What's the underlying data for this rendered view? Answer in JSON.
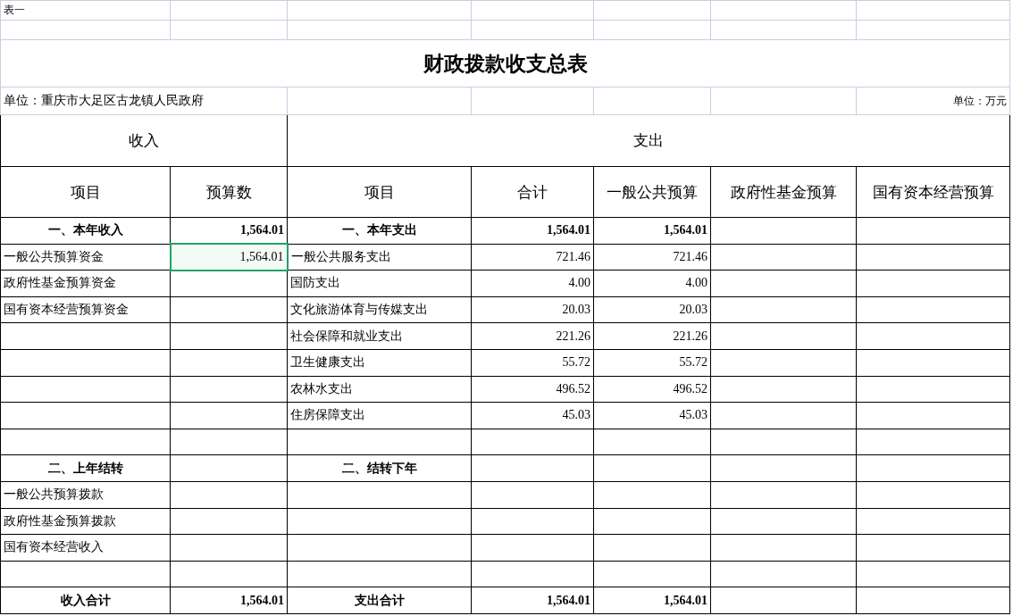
{
  "sheet": {
    "label": "表一"
  },
  "title": "财政拨款收支总表",
  "unit_row": {
    "organization": "单位：重庆市大足区古龙镇人民政府",
    "unit": "单位：万元"
  },
  "header": {
    "income": "收入",
    "expense": "支出",
    "columns": [
      "项目",
      "预算数",
      "项目",
      "合计",
      "一般公共预算",
      "政府性基金预算",
      "国有资本经营预算"
    ]
  },
  "rows": [
    {
      "kind": "section",
      "cells": [
        {
          "text": "一、本年收入",
          "selected": false
        },
        {
          "text": "1,564.01",
          "selected": false
        },
        {
          "text": "一、本年支出",
          "selected": false
        },
        {
          "text": "1,564.01",
          "selected": false
        },
        {
          "text": "1,564.01",
          "selected": false
        },
        {
          "selected": false
        },
        {
          "selected": false
        }
      ]
    },
    {
      "kind": "item",
      "cells": [
        {
          "text": "一般公共预算资金",
          "selected": false
        },
        {
          "text": "1,564.01",
          "selected": true
        },
        {
          "text": "一般公共服务支出",
          "selected": false
        },
        {
          "text": "721.46",
          "selected": false
        },
        {
          "text": "721.46",
          "selected": false
        },
        {
          "selected": false
        },
        {
          "selected": false
        }
      ]
    },
    {
      "kind": "item",
      "cells": [
        {
          "text": "政府性基金预算资金",
          "selected": false
        },
        {
          "selected": false
        },
        {
          "text": "国防支出",
          "selected": false
        },
        {
          "text": "4.00",
          "selected": false
        },
        {
          "text": "4.00",
          "selected": false
        },
        {
          "selected": false
        },
        {
          "selected": false
        }
      ]
    },
    {
      "kind": "item",
      "cells": [
        {
          "text": "国有资本经营预算资金",
          "selected": false
        },
        {
          "selected": false
        },
        {
          "text": "文化旅游体育与传媒支出",
          "selected": false
        },
        {
          "text": "20.03",
          "selected": false
        },
        {
          "text": "20.03",
          "selected": false
        },
        {
          "selected": false
        },
        {
          "selected": false
        }
      ]
    },
    {
      "kind": "item",
      "cells": [
        {
          "selected": false
        },
        {
          "selected": false
        },
        {
          "text": "社会保障和就业支出",
          "selected": false
        },
        {
          "text": "221.26",
          "selected": false
        },
        {
          "text": "221.26",
          "selected": false
        },
        {
          "selected": false
        },
        {
          "selected": false
        }
      ]
    },
    {
      "kind": "item",
      "cells": [
        {
          "selected": false
        },
        {
          "selected": false
        },
        {
          "text": "卫生健康支出",
          "selected": false
        },
        {
          "text": "55.72",
          "selected": false
        },
        {
          "text": "55.72",
          "selected": false
        },
        {
          "selected": false
        },
        {
          "selected": false
        }
      ]
    },
    {
      "kind": "item",
      "cells": [
        {
          "selected": false
        },
        {
          "selected": false
        },
        {
          "text": "农林水支出",
          "selected": false
        },
        {
          "text": "496.52",
          "selected": false
        },
        {
          "text": "496.52",
          "selected": false
        },
        {
          "selected": false
        },
        {
          "selected": false
        }
      ]
    },
    {
      "kind": "item",
      "cells": [
        {
          "selected": false
        },
        {
          "selected": false
        },
        {
          "text": "住房保障支出",
          "selected": false
        },
        {
          "text": "45.03",
          "selected": false
        },
        {
          "text": "45.03",
          "selected": false
        },
        {
          "selected": false
        },
        {
          "selected": false
        }
      ]
    },
    {
      "kind": "item",
      "cells": [
        {
          "selected": false
        },
        {
          "selected": false
        },
        {
          "selected": false
        },
        {
          "selected": false
        },
        {
          "selected": false
        },
        {
          "selected": false
        },
        {
          "selected": false
        }
      ]
    },
    {
      "kind": "section",
      "cells": [
        {
          "text": "二、上年结转",
          "selected": false
        },
        {
          "selected": false
        },
        {
          "text": "二、结转下年",
          "selected": false
        },
        {
          "selected": false
        },
        {
          "selected": false
        },
        {
          "selected": false
        },
        {
          "selected": false
        }
      ]
    },
    {
      "kind": "item",
      "cells": [
        {
          "text": "一般公共预算拨款",
          "selected": false
        },
        {
          "selected": false
        },
        {
          "selected": false
        },
        {
          "selected": false
        },
        {
          "selected": false
        },
        {
          "selected": false
        },
        {
          "selected": false
        }
      ]
    },
    {
      "kind": "item",
      "cells": [
        {
          "text": "政府性基金预算拨款",
          "selected": false
        },
        {
          "selected": false
        },
        {
          "selected": false
        },
        {
          "selected": false
        },
        {
          "selected": false
        },
        {
          "selected": false
        },
        {
          "selected": false
        }
      ]
    },
    {
      "kind": "item",
      "cells": [
        {
          "text": "国有资本经营收入",
          "selected": false
        },
        {
          "selected": false
        },
        {
          "selected": false
        },
        {
          "selected": false
        },
        {
          "selected": false
        },
        {
          "selected": false
        },
        {
          "selected": false
        }
      ]
    },
    {
      "kind": "item",
      "cells": [
        {
          "selected": false
        },
        {
          "selected": false
        },
        {
          "selected": false
        },
        {
          "selected": false
        },
        {
          "selected": false
        },
        {
          "selected": false
        },
        {
          "selected": false
        }
      ]
    },
    {
      "kind": "total",
      "cells": [
        {
          "text": "收入合计",
          "selected": false
        },
        {
          "text": "1,564.01",
          "selected": false
        },
        {
          "text": "支出合计",
          "selected": false
        },
        {
          "text": "1,564.01",
          "selected": false
        },
        {
          "text": "1,564.01",
          "selected": false
        },
        {
          "selected": false
        },
        {
          "selected": false
        }
      ]
    }
  ]
}
